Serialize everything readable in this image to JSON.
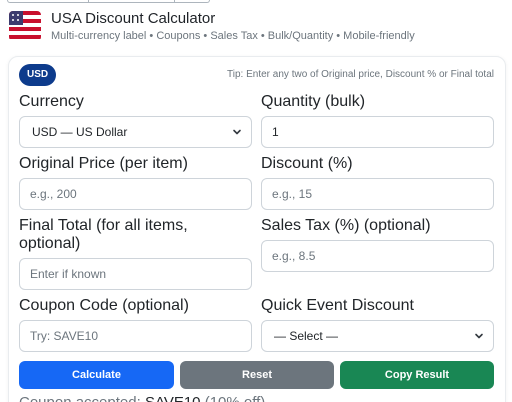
{
  "header": {
    "title": "USA Discount Calculator",
    "subtitle": "Multi-currency label • Coupons • Sales Tax • Bulk/Quantity • Mobile-friendly",
    "flag_icon": "us-flag-icon"
  },
  "badge": {
    "label": "USD",
    "color": "#0d3b8c"
  },
  "tip": "Tip: Enter any two of Original price, Discount % or Final total",
  "fields": {
    "currency": {
      "label": "Currency",
      "value": "USD — US Dollar"
    },
    "quantity": {
      "label": "Quantity (bulk)",
      "value": "1"
    },
    "original_price": {
      "label": "Original Price (per item)",
      "placeholder": "e.g., 200"
    },
    "discount": {
      "label": "Discount (%)",
      "placeholder": "e.g., 15"
    },
    "final_total": {
      "label": "Final Total (for all items, optional)",
      "placeholder": "Enter if known"
    },
    "sales_tax": {
      "label": "Sales Tax (%) (optional)",
      "placeholder": "e.g., 8.5"
    },
    "coupon": {
      "label": "Coupon Code (optional)",
      "placeholder": "Try: SAVE10"
    },
    "quick_event": {
      "label": "Quick Event Discount",
      "value": "— Select —"
    }
  },
  "buttons": {
    "calculate": "Calculate",
    "reset": "Reset",
    "copy": "Copy Result"
  },
  "colors": {
    "calculate": "#1668f5",
    "reset": "#6c757d",
    "copy": "#198754"
  },
  "coupon_status": {
    "prefix": "Coupon accepted:",
    "code": "SAVE10",
    "suffix": "(10% off)"
  }
}
